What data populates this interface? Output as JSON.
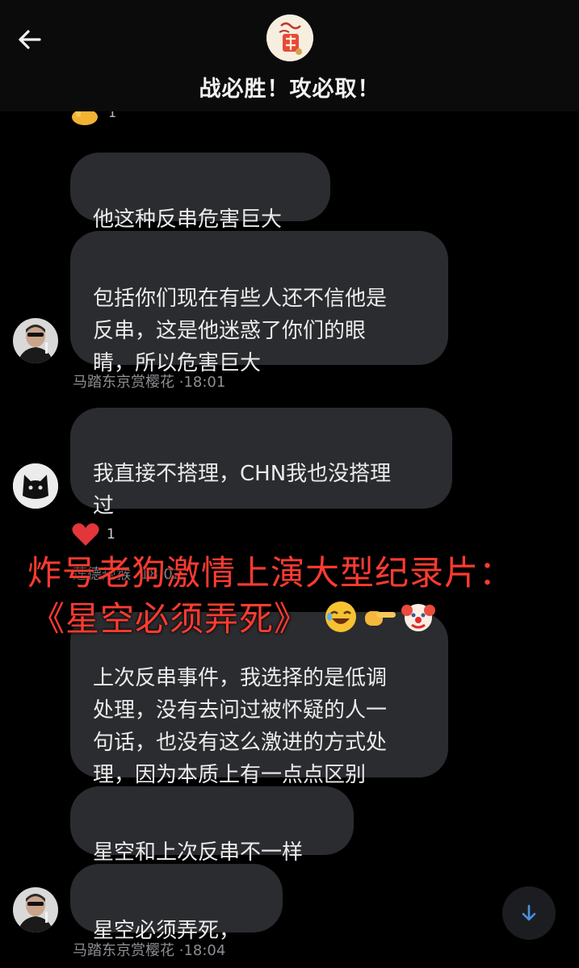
{
  "header": {
    "title": "战必胜！攻必取！",
    "back_icon": "arrow-left-icon",
    "avatar_icon": "dragon-seal-icon"
  },
  "partial_reaction": {
    "emoji": "hand-icon",
    "count": "1"
  },
  "messages": [
    {
      "text": "他这种反串危害巨大"
    },
    {
      "text": "包括你们现在有些人还不信他是\n反串，这是他迷惑了你们的眼\n睛，所以危害巨大"
    },
    {
      "text": "我直接不搭理，CHN我也没搭理\n过"
    },
    {
      "text": "上次反串事件，我选择的是低调\n处理，没有去问过被怀疑的人一\n句话，也没有这么激进的方式处\n理，因为本质上有一点点区别"
    },
    {
      "text": "星空和上次反串不一样"
    },
    {
      "text": "星空必须弄死，"
    }
  ],
  "senders": [
    {
      "name": "马踏东京赏樱花",
      "time": "·18:01"
    },
    {
      "name": "马踏东京赏樱花",
      "time": "·18:04"
    }
  ],
  "cat_reaction": {
    "emoji": "heart-icon",
    "count": "1"
  },
  "obscured_meta": {
    "text": "莲德规猴 ·18:02"
  },
  "overlay": {
    "line1": "炸号老狗激情上演大型纪录片：",
    "line2": "《星空必须弄死》"
  },
  "colors": {
    "background": "#000000",
    "bubble": "#2b2c2f",
    "overlay_text": "#ff3b30",
    "meta_text": "#8e8e93",
    "scroll_arrow": "#4a90e2"
  }
}
